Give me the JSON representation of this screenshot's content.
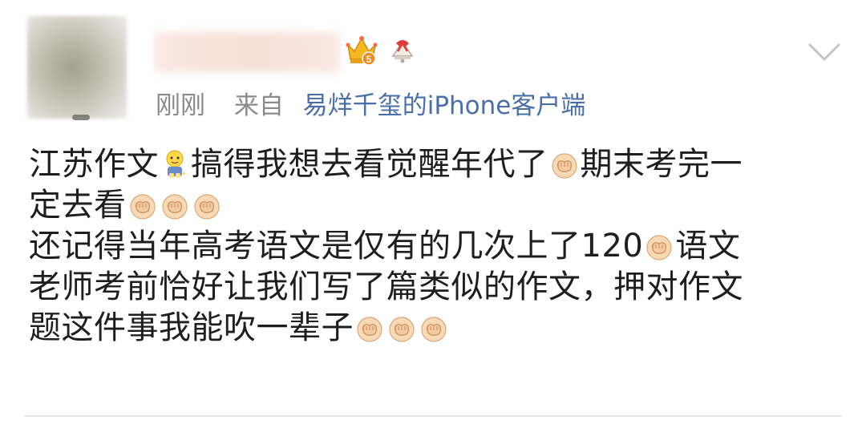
{
  "post": {
    "time": "刚刚",
    "from_label": "来自",
    "client": "易烊千玺的iPhone客户端",
    "level_badge": "5",
    "content_lines": [
      [
        "江苏作文",
        "{baby}",
        "搞得我想去看觉醒年代了",
        "{fist}",
        "期末考完一"
      ],
      [
        "定去看",
        "{fist}",
        "{fist}",
        "{fist}"
      ],
      [
        "还记得当年高考语文是仅有的几次上了120",
        "{fist}",
        "语文"
      ],
      [
        "老师考前恰好让我们写了篇类似的作文，押对作文"
      ],
      [
        "题这件事我能吹一辈子",
        "{fist}",
        "{fist}",
        "{fist}"
      ]
    ]
  },
  "icons": {
    "avatar": "avatar-image",
    "crown": "crown-icon",
    "bell": "bell-icon",
    "menu": "chevron-down-icon",
    "emoji_fist": "fist-icon",
    "emoji_baby": "baby-icon"
  },
  "colors": {
    "meta_text": "#8a8a8a",
    "client_link": "#4a6fa8",
    "body_text": "#1e1e1e"
  }
}
